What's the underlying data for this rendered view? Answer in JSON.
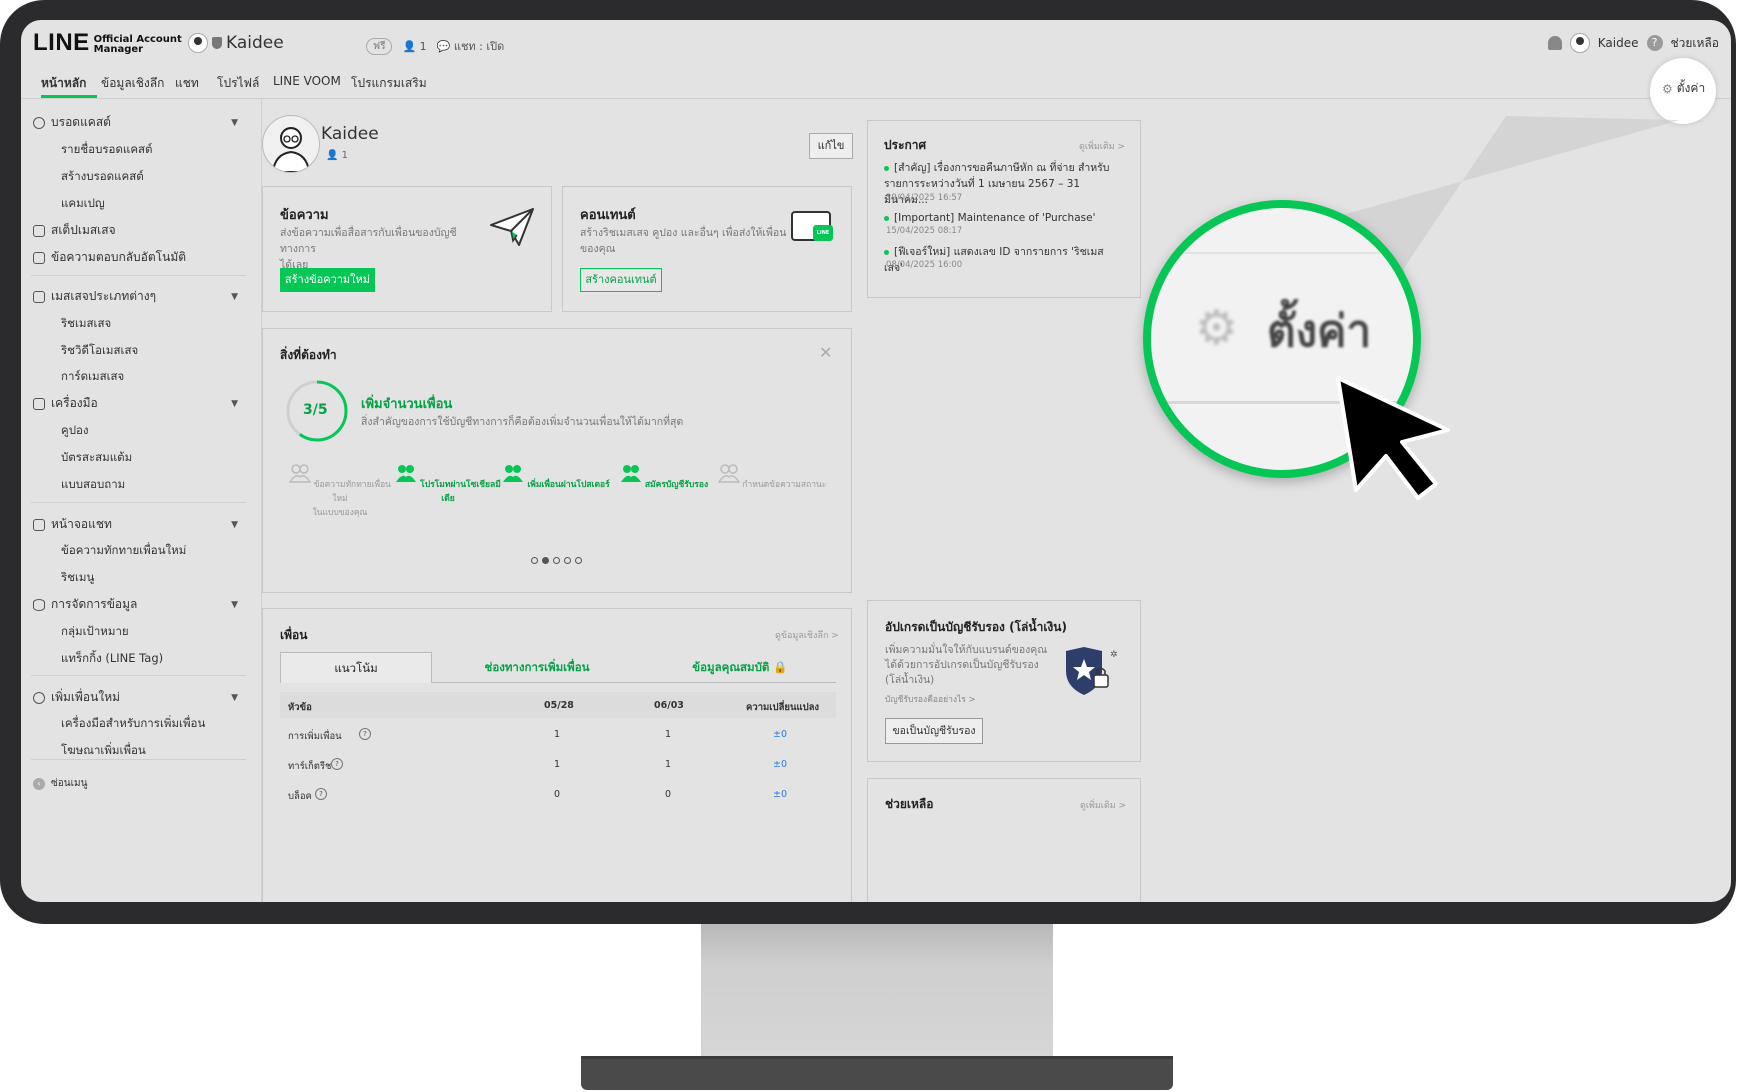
{
  "header": {
    "logo_main": "LINE",
    "logo_sub1": "Official Account",
    "logo_sub2": "Manager",
    "account_name": "Kaidee",
    "plan_badge": "ฟรี",
    "friend_count": "1",
    "chat_status": "แชท : เปิด",
    "user_name": "Kaidee",
    "help_label": "ช่วยเหลือ"
  },
  "nav": {
    "items": [
      "หน้าหลัก",
      "ข้อมูลเชิงลึก",
      "แชท",
      "โปรไฟล์",
      "LINE VOOM",
      "โปรแกรมเสริม"
    ],
    "settings_label": "ตั้งค่า"
  },
  "sidebar": {
    "broadcast": "บรอดแคสต์",
    "broadcast_list": "รายชื่อบรอดแคสต์",
    "create_broadcast": "สร้างบรอดแคสต์",
    "campaign": "แคมเปญ",
    "step_message": "สเต็ปเมสเสจ",
    "auto_reply": "ข้อความตอบกลับอัตโนมัติ",
    "message_types": "เมสเสจประเภทต่างๆ",
    "rich_message": "ริชเมสเสจ",
    "rich_video": "ริชวิดีโอเมสเสจ",
    "card_message": "การ์ดเมสเสจ",
    "tools": "เครื่องมือ",
    "coupon": "คูปอง",
    "reward_card": "บัตรสะสมแต้ม",
    "survey": "แบบสอบถาม",
    "chat_screen": "หน้าจอแชท",
    "greeting": "ข้อความทักทายเพื่อนใหม่",
    "rich_menu": "ริชเมนู",
    "data_management": "การจัดการข้อมูล",
    "audience": "กลุ่มเป้าหมาย",
    "line_tag": "แทร็กกิ้ง (LINE Tag)",
    "add_friends": "เพิ่มเพื่อนใหม่",
    "friend_tools": "เครื่องมือสำหรับการเพิ่มเพื่อน",
    "friend_ads": "โฆษณาเพิ่มเพื่อน",
    "collapse": "ซ่อนเมนู"
  },
  "profile": {
    "name": "Kaidee",
    "count": "1",
    "edit": "แก้ไข"
  },
  "message_card": {
    "title": "ข้อความ",
    "desc_line1": "ส่งข้อความเพื่อสื่อสารกับเพื่อนของบัญชีทางการ",
    "desc_line2": "ได้เลย",
    "button": "สร้างข้อความใหม่"
  },
  "content_card": {
    "title": "คอนเทนต์",
    "desc_line1": "สร้างริชเมสเสจ คูปอง และอื่นๆ เพื่อส่งให้เพื่อน",
    "desc_line2": "ของคุณ",
    "button": "สร้างคอนเทนต์",
    "badge": "LINE"
  },
  "announcements": {
    "title": "ประกาศ",
    "see_more": "ดูเพิ่มเติม >",
    "items": [
      {
        "line1": "[สำคัญ] เรื่องการขอคืนภาษีหัก ณ ที่จ่าย สำหรับ",
        "line2": "รายการระหว่างวันที่ 1 เมษายน 2567 – 31 มีนาคม...",
        "date": "29/04/2025 16:57"
      },
      {
        "line1": "[Important] Maintenance of 'Purchase'",
        "line2": "",
        "date": "15/04/2025 08:17"
      },
      {
        "line1": "[ฟีเจอร์ใหม่] แสดงเลข ID จากรายการ 'ริชเมสเสจ'",
        "line2": "",
        "date": "08/04/2025 16:00"
      }
    ]
  },
  "todo": {
    "title": "สิ่งที่ต้องทำ",
    "progress_text": "3/5",
    "progress_fraction": 0.6,
    "heading": "เพิ่มจำนวนเพื่อน",
    "desc": "สิ่งสำคัญของการใช้บัญชีทางการก็คือต้องเพิ่มจำนวนเพื่อนให้ได้มากที่สุด",
    "steps": [
      {
        "line1": "ข้อความทักทายเพื่อนใหม่",
        "line2": "ในแบบของคุณ",
        "done": false
      },
      {
        "line1": "โปรโมทผ่านโซเชียลมีเดีย",
        "line2": "",
        "done": true
      },
      {
        "line1": "เพิ่มเพื่อนผ่านโปสเตอร์",
        "line2": "",
        "done": true
      },
      {
        "line1": "สมัครบัญชีรับรอง",
        "line2": "",
        "done": true
      },
      {
        "line1": "กำหนดข้อความสถานะ",
        "line2": "",
        "done": false
      }
    ]
  },
  "friends": {
    "title": "เพื่อน",
    "see_insights": "ดูข้อมูลเชิงลึก >",
    "tabs": [
      "แนวโน้ม",
      "ช่องทางการเพิ่มเพื่อน",
      "ข้อมูลคุณสมบัติ"
    ],
    "columns": [
      "หัวข้อ",
      "05/28",
      "06/03",
      "ความเปลี่ยนแปลง"
    ],
    "rows": [
      {
        "label": "การเพิ่มเพื่อน",
        "a": "1",
        "b": "1",
        "change": "±0"
      },
      {
        "label": "ทาร์เก็ตรีช",
        "a": "1",
        "b": "1",
        "change": "±0"
      },
      {
        "label": "บล็อค",
        "a": "0",
        "b": "0",
        "change": "±0"
      }
    ]
  },
  "verified": {
    "title": "อัปเกรดเป็นบัญชีรับรอง (โล่น้ำเงิน)",
    "desc_line1": "เพิ่มความมั่นใจให้กับแบรนด์ของคุณ",
    "desc_line2": "ได้ด้วยการอัปเกรดเป็นบัญชีรับรอง",
    "desc_line3": "(โล่น้ำเงิน)",
    "link": "บัญชีรับรองคืออย่างไร >",
    "button": "ขอเป็นบัญชีรับรอง"
  },
  "help_card": {
    "title": "ช่วยเหลือ",
    "see_more": "ดูเพิ่มเติม >"
  },
  "magnifier": {
    "label": "ตั้งค่า"
  },
  "colors": {
    "accent": "#06c755",
    "bezel": "#2b2b2d",
    "screen_bg": "#e3e3e3"
  }
}
